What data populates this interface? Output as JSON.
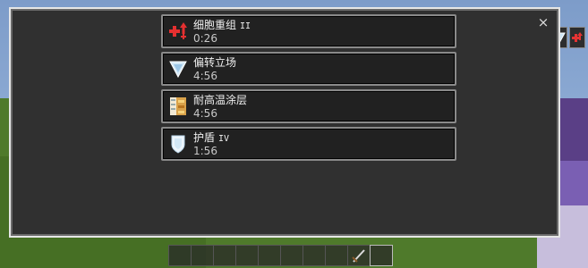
{
  "panel": {
    "close_label": "×"
  },
  "effects": [
    {
      "name": "细胞重组",
      "level": "II",
      "time": "0:26",
      "icon": "red-cross-arrow-icon"
    },
    {
      "name": "偏转立场",
      "level": "",
      "time": "4:56",
      "icon": "triangle-shield-icon"
    },
    {
      "name": "耐高温涂层",
      "level": "",
      "time": "4:56",
      "icon": "heat-coating-icon"
    },
    {
      "name": "护盾",
      "level": "IV",
      "time": "1:56",
      "icon": "shield-icon"
    }
  ],
  "colors": {
    "panel_bg": "#303030",
    "row_bg": "#212121",
    "row_border": "#8a8a8a",
    "text": "#f0f0f0"
  },
  "hotbar": {
    "slot_count": 10
  }
}
